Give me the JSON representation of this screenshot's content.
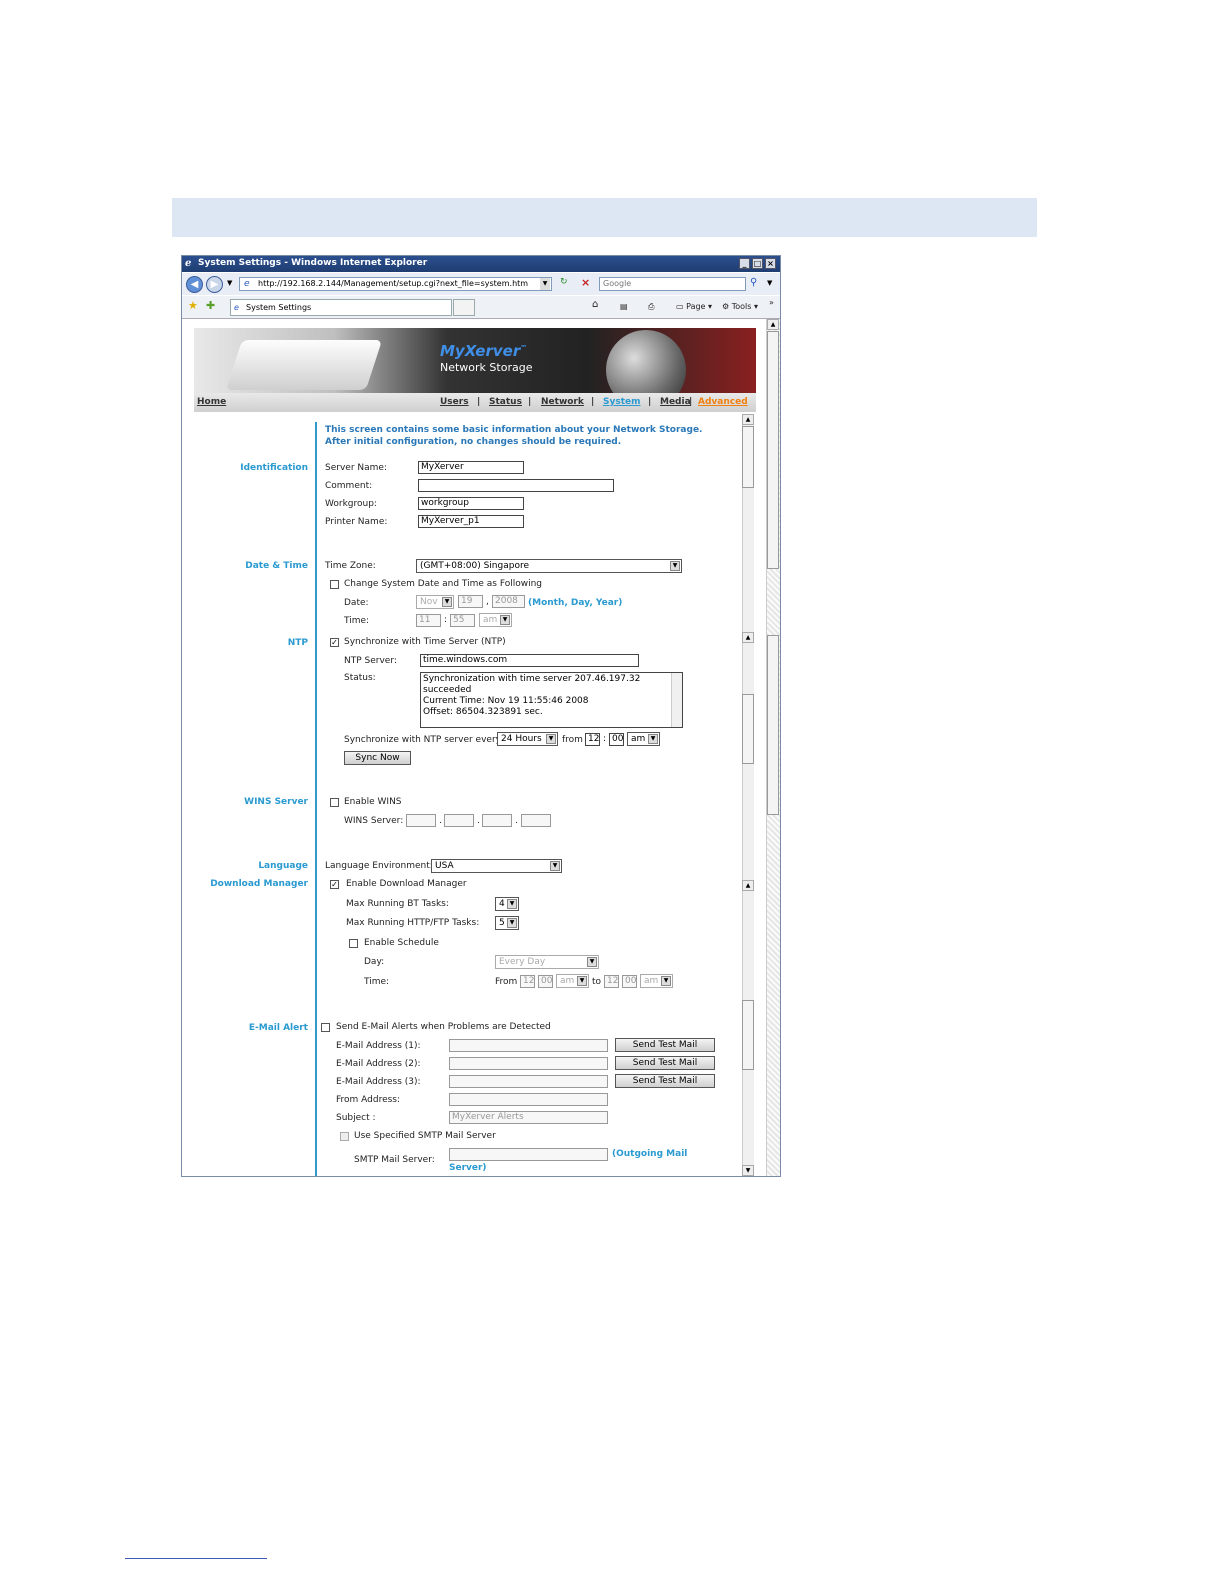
{
  "window": {
    "title": "System Settings - Windows Internet Explorer",
    "address": "http://192.168.2.144/Management/setup.cgi?next_file=system.htm",
    "search_placeholder": "Google",
    "tab_label": "System Settings",
    "tools": {
      "page": "Page",
      "tools": "Tools"
    }
  },
  "banner": {
    "logo": "MyXerver",
    "logo_tm": "™",
    "tagline": "Network Storage"
  },
  "nav": {
    "home": "Home",
    "users": "Users",
    "status": "Status",
    "network": "Network",
    "system": "System",
    "media": "Media",
    "advanced": "Advanced",
    "separator": "|",
    "colors": {
      "active": "#2a9ad0",
      "advanced": "#f08010"
    }
  },
  "intro": {
    "line1": "This screen contains some basic information about your Network Storage.",
    "line2": "After initial configuration, no changes should be required."
  },
  "identification": {
    "heading": "Identification",
    "server_name_label": "Server Name:",
    "server_name": "MyXerver",
    "comment_label": "Comment:",
    "comment": "",
    "workgroup_label": "Workgroup:",
    "workgroup": "workgroup",
    "printer_name_label": "Printer Name:",
    "printer_name": "MyXerver_p1"
  },
  "datetime": {
    "heading": "Date & Time",
    "timezone_label": "Time Zone:",
    "timezone": "(GMT+08:00) Singapore",
    "change_label": "Change System Date and Time as Following",
    "date_label": "Date:",
    "month": "Nov",
    "day": "19",
    "year": "2008",
    "date_hint": "(Month, Day, Year)",
    "time_label": "Time:",
    "hour": "11",
    "minute": "55",
    "ampm": "am",
    "colon": ":",
    "comma": ","
  },
  "ntp": {
    "heading": "NTP",
    "sync_label": "Synchronize with Time Server (NTP)",
    "sync_checked": true,
    "server_label": "NTP Server:",
    "server": "time.windows.com",
    "status_label": "Status:",
    "status_lines": [
      "Synchronization with time server 207.46.197.32",
      "succeeded",
      "Current Time: Nov 19 11:55:46 2008",
      "Offset: 86504.323891 sec."
    ],
    "every_label": "Synchronize with NTP server every",
    "interval": "24 Hours",
    "from_label": "from",
    "from_hour": "12",
    "from_minute": "00",
    "from_ampm": "am",
    "sync_now": "Sync Now"
  },
  "wins": {
    "heading": "WINS Server",
    "enable_label": "Enable WINS",
    "server_label": "WINS Server:",
    "dot": "."
  },
  "language": {
    "heading": "Language",
    "env_label": "Language Environment:",
    "env": "USA"
  },
  "download": {
    "heading": "Download Manager",
    "enable_label": "Enable Download Manager",
    "enabled": true,
    "bt_label": "Max Running BT Tasks:",
    "bt": "4",
    "http_label": "Max Running HTTP/FTP Tasks:",
    "http": "5",
    "schedule_label": "Enable Schedule",
    "day_label": "Day:",
    "day": "Every Day",
    "time_label": "Time:",
    "from_label": "From",
    "to_label": "to",
    "from_hour": "12",
    "from_minute": "00",
    "from_ampm": "am",
    "to_hour": "12",
    "to_minute": "00",
    "to_ampm": "am"
  },
  "email": {
    "heading": "E-Mail Alert",
    "enable_label": "Send E-Mail Alerts when Problems are Detected",
    "addr1_label": "E-Mail Address (1):",
    "addr2_label": "E-Mail Address (2):",
    "addr3_label": "E-Mail Address (3):",
    "send_test": "Send Test Mail",
    "from_label": "From Address:",
    "subject_label": "Subject :",
    "subject": "MyXerver Alerts",
    "smtp_enable_label": "Use Specified SMTP Mail Server",
    "smtp_label": "SMTP Mail Server:",
    "smtp_hint1": "(Outgoing Mail",
    "smtp_hint2": "Server)"
  }
}
